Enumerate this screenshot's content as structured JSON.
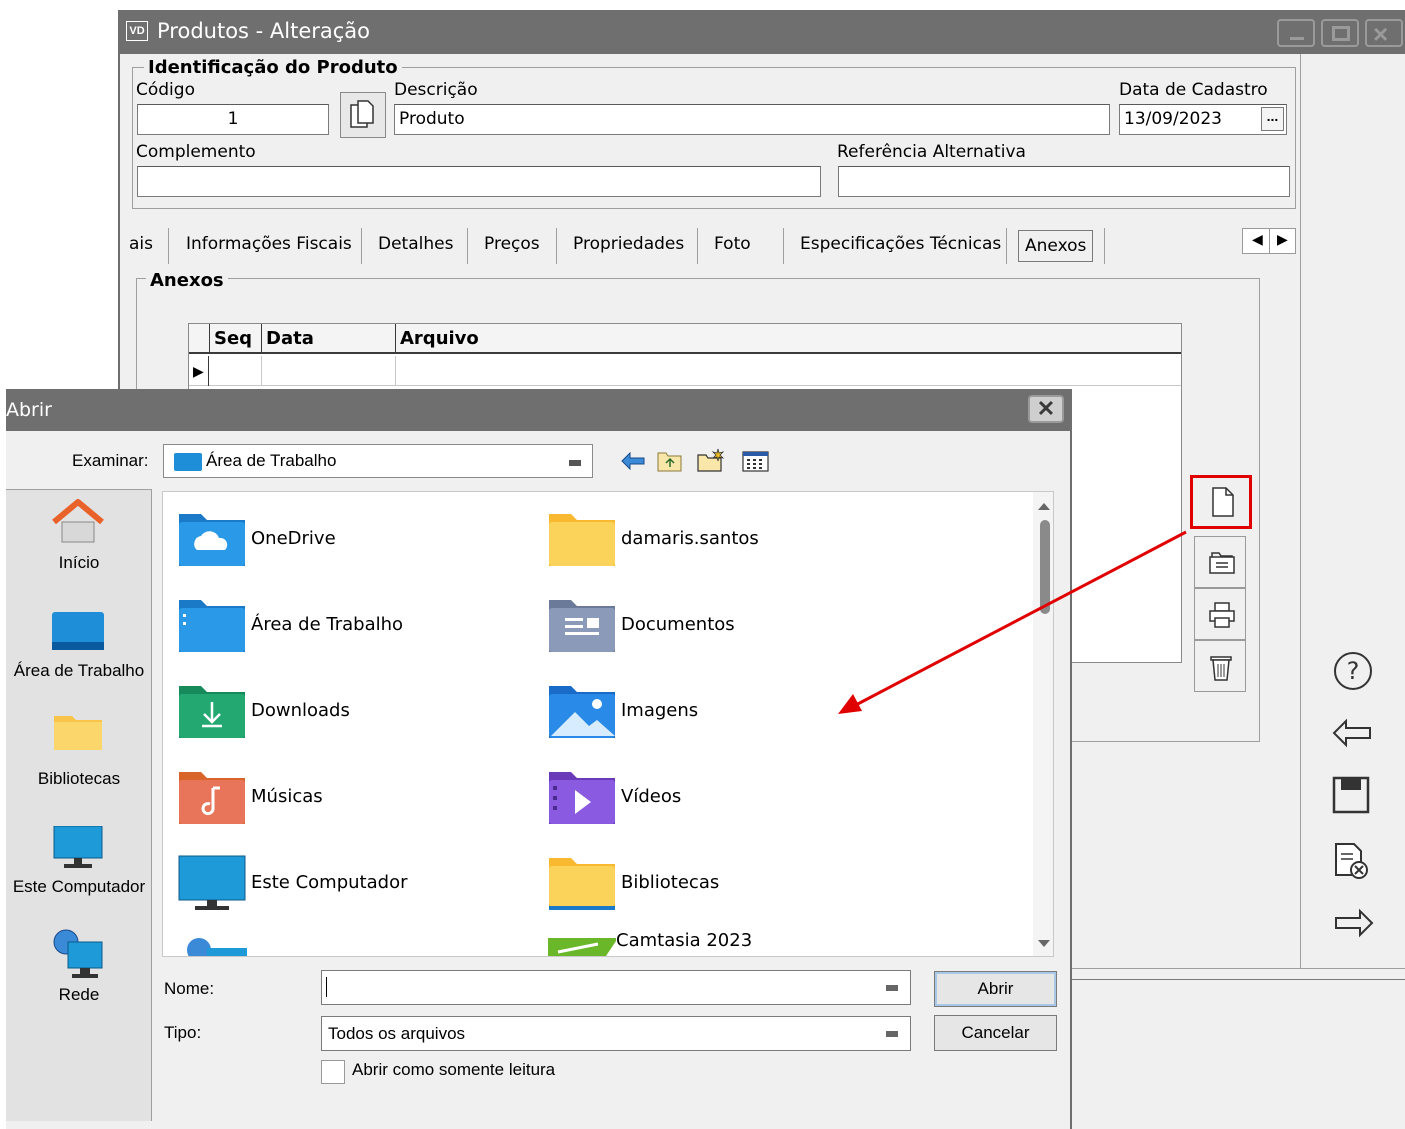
{
  "main_window": {
    "logo": "VD",
    "title": "Produtos - Alteração",
    "ident_legend": "Identificação do Produto",
    "codigo_label": "Código",
    "codigo_value": "1",
    "descricao_label": "Descrição",
    "descricao_value": "Produto",
    "data_cadastro_label": "Data de Cadastro",
    "data_cadastro_value": "13/09/2023",
    "date_button": "...",
    "complemento_label": "Complemento",
    "complemento_value": "",
    "ref_alt_label": "Referência Alternativa",
    "ref_alt_value": "",
    "tabs": [
      "ais",
      "Informações Fiscais",
      "Detalhes",
      "Preços",
      "Propriedades",
      "Foto",
      "Especificações Técnicas",
      "Anexos"
    ],
    "active_tab": "Anexos",
    "anexos_legend": "Anexos",
    "grid_columns": [
      "Seq",
      "Data",
      "Arquivo"
    ]
  },
  "dialog": {
    "title": "Abrir",
    "lookin_label": "Examinar:",
    "lookin_value": "Área de Trabalho",
    "places": [
      "Início",
      "Área de Trabalho",
      "Bibliotecas",
      "Este Computador",
      "Rede"
    ],
    "files_col1": [
      "OneDrive",
      "Área de Trabalho",
      "Downloads",
      "Músicas",
      "Este Computador"
    ],
    "files_col2": [
      "damaris.santos",
      "Documentos",
      "Imagens",
      "Vídeos",
      "Bibliotecas",
      "Camtasia 2023"
    ],
    "nome_label": "Nome:",
    "nome_value": "",
    "tipo_label": "Tipo:",
    "tipo_value": "Todos os arquivos",
    "open_button": "Abrir",
    "cancel_button": "Cancelar",
    "readonly_label": "Abrir como somente leitura"
  },
  "colors": {
    "titlebar": "#6f6f6f",
    "highlight": "#e00000",
    "folder_yellow": "#f8c44a",
    "folder_blue": "#1e8ed8"
  }
}
